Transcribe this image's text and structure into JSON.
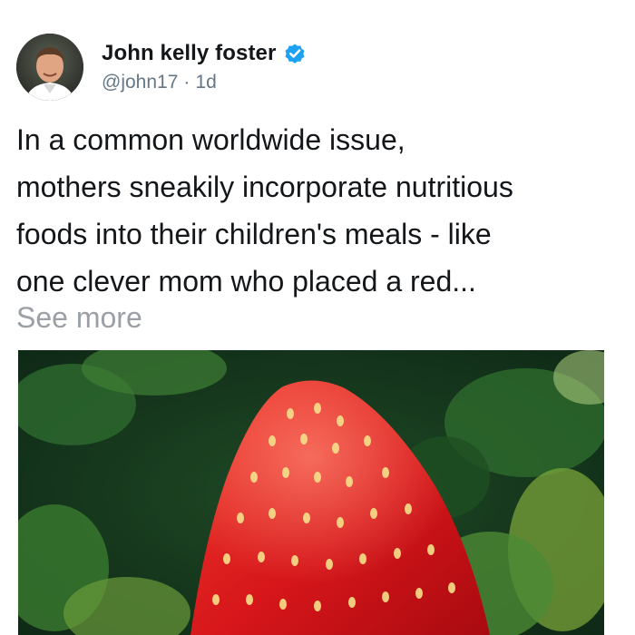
{
  "author": {
    "name": "John kelly foster",
    "handle": "@john17",
    "separator": "·",
    "time": "1d"
  },
  "tweet": {
    "text_lines": [
      "In a common worldwide issue,",
      "mothers sneakily incorporate nutritious",
      "foods into their children's meals - like",
      "one clever mom who placed a red..."
    ],
    "see_more_label": "See more"
  },
  "icons": {
    "verified": "verified-badge-icon",
    "avatar": "profile-photo"
  },
  "colors": {
    "verified_blue": "#1da1f2",
    "text": "#14171a",
    "muted": "#657786"
  }
}
